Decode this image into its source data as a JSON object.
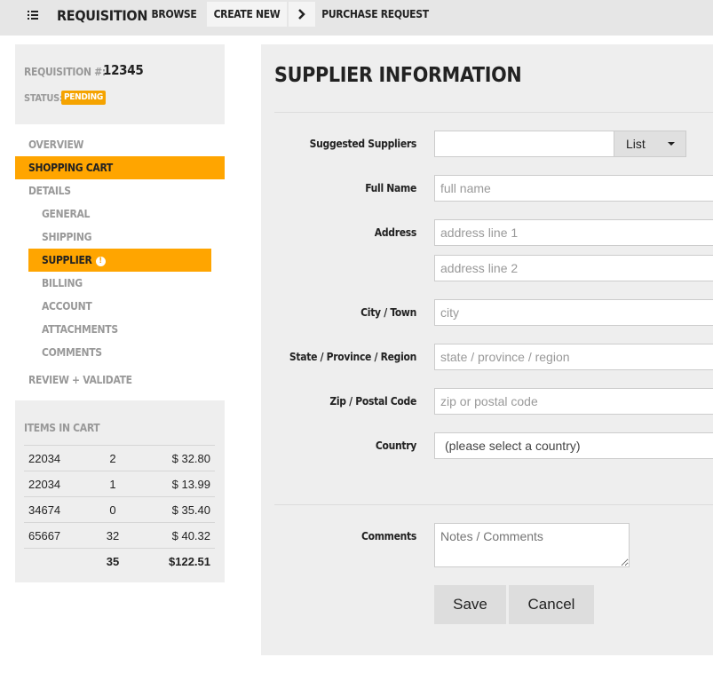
{
  "header": {
    "app_title": "REQUISITION",
    "nav": {
      "browse": "BROWSE",
      "create_new": "CREATE NEW",
      "purchase_request": "PURCHASE REQUEST"
    }
  },
  "requisition": {
    "number_label": "REQUISITION #:",
    "number": "12345",
    "status_label": "STATUS:",
    "status": "PENDING"
  },
  "sidebar": {
    "overview": "OVERVIEW",
    "shopping_cart": "SHOPPING CART",
    "details": "DETAILS",
    "general": "GENERAL",
    "shipping": "SHIPPING",
    "supplier": "SUPPLIER",
    "billing": "BILLING",
    "account": "ACCOUNT",
    "attachments": "ATTACHMENTS",
    "comments": "COMMENTS",
    "review_validate": "REVIEW + VALIDATE"
  },
  "cart": {
    "title": "ITEMS IN CART",
    "rows": [
      {
        "id": "22034",
        "qty": "2",
        "price": "$ 32.80"
      },
      {
        "id": "22034",
        "qty": "1",
        "price": "$ 13.99"
      },
      {
        "id": "34674",
        "qty": "0",
        "price": "$ 35.40"
      },
      {
        "id": "65667",
        "qty": "32",
        "price": "$ 40.32"
      }
    ],
    "total_qty": "35",
    "total_price": "$122.51"
  },
  "form": {
    "title": "SUPPLIER INFORMATION",
    "suggested_suppliers_label": "Suggested Suppliers",
    "list_button": "List",
    "full_name_label": "Full Name",
    "full_name_placeholder": "full name",
    "address_label": "Address",
    "address1_placeholder": "address line 1",
    "address2_placeholder": "address line 2",
    "city_label": "City / Town",
    "city_placeholder": "city",
    "state_label": "State / Province / Region",
    "state_placeholder": "state / province / region",
    "zip_label": "Zip / Postal Code",
    "zip_placeholder": "zip or postal code",
    "country_label": "Country",
    "country_value": "(please select a country)",
    "comments_label": "Comments",
    "comments_placeholder": "Notes / Comments",
    "save": "Save",
    "cancel": "Cancel"
  },
  "colors": {
    "accent": "#ffa500",
    "panel": "#eeeeee",
    "topbar": "#e6e6e6"
  }
}
